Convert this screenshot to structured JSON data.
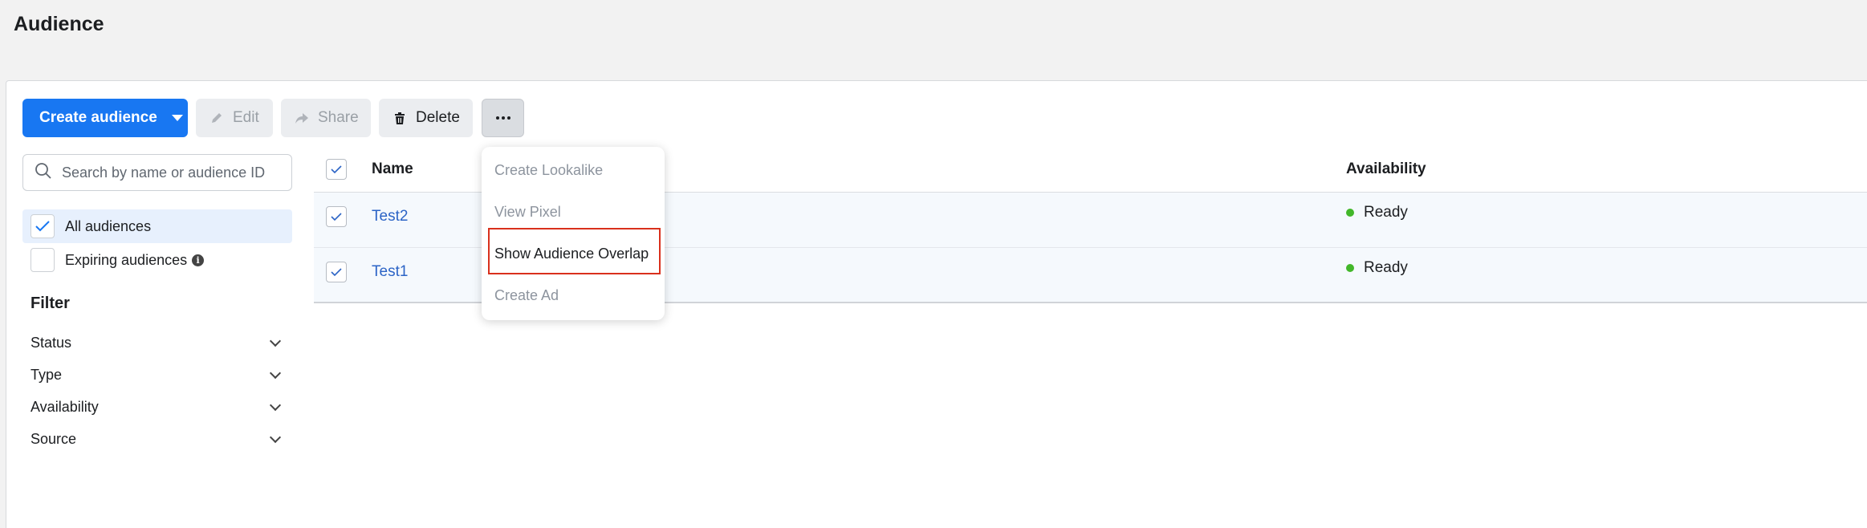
{
  "page": {
    "title": "Audience"
  },
  "toolbar": {
    "create_label": "Create audience",
    "edit_label": "Edit",
    "share_label": "Share",
    "delete_label": "Delete"
  },
  "sidebar": {
    "search_placeholder": "Search by name or audience ID",
    "views": [
      {
        "label": "All audiences",
        "checked": true
      },
      {
        "label": "Expiring audiences",
        "checked": false
      }
    ],
    "filter_title": "Filter",
    "filters": [
      "Status",
      "Type",
      "Availability",
      "Source"
    ]
  },
  "table": {
    "headers": {
      "name": "Name",
      "availability": "Availability"
    },
    "rows": [
      {
        "name": "Test2",
        "availability": "Ready"
      },
      {
        "name": "Test1",
        "availability": "Ready"
      }
    ]
  },
  "more_menu": {
    "items": [
      {
        "label": "Create Lookalike",
        "enabled": false
      },
      {
        "label": "View Pixel",
        "enabled": false
      },
      {
        "label": "Show Audience Overlap",
        "enabled": true
      },
      {
        "label": "Create Ad",
        "enabled": false
      }
    ]
  },
  "colors": {
    "primary": "#1877f2",
    "link": "#2c64c6",
    "ready": "#42b72a",
    "highlight": "#d9301c"
  }
}
